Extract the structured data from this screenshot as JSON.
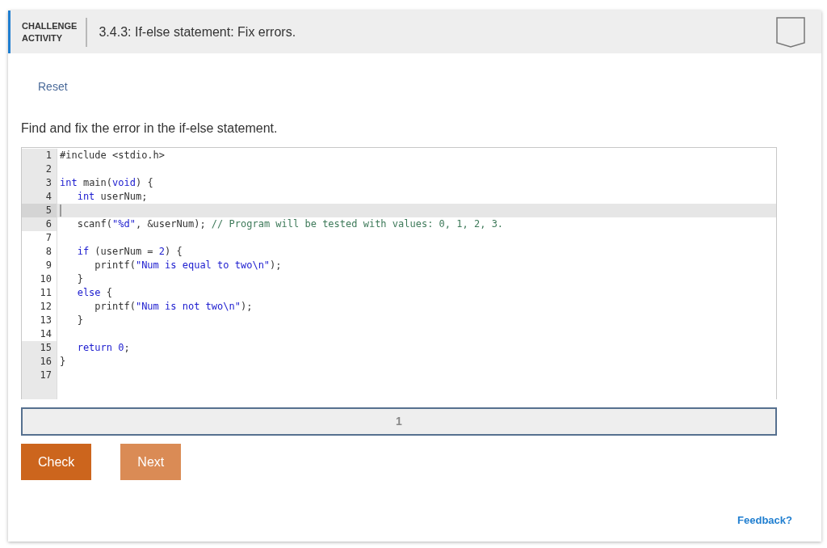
{
  "header": {
    "label_lines": [
      "CHALLENGE",
      "ACTIVITY"
    ],
    "title": "3.4.3: If-else statement: Fix errors."
  },
  "reset": "Reset",
  "instructions": "Find and fix the error in the if-else statement.",
  "editor": {
    "lines": [
      {
        "number": "1",
        "locked": true,
        "active": false,
        "tokens": [
          {
            "kind": "plain",
            "text": "#include <stdio.h>"
          }
        ]
      },
      {
        "number": "2",
        "locked": true,
        "active": false
      },
      {
        "number": "3",
        "locked": true,
        "active": false,
        "tokens": [
          {
            "kind": "keyword",
            "text": "int"
          },
          {
            "kind": "plain",
            "text": " main("
          },
          {
            "kind": "keyword",
            "text": "void"
          },
          {
            "kind": "plain",
            "text": ") {"
          }
        ]
      },
      {
        "number": "4",
        "locked": true,
        "active": false,
        "tokens": [
          {
            "kind": "keyword",
            "text": "   int"
          },
          {
            "kind": "plain",
            "text": " userNum;"
          }
        ]
      },
      {
        "number": "5",
        "locked": true,
        "active": true
      },
      {
        "number": "6",
        "locked": true,
        "active": false,
        "tokens": [
          {
            "kind": "plain",
            "text": "   scanf("
          },
          {
            "kind": "string",
            "text": "\"%d\""
          },
          {
            "kind": "plain",
            "text": ", &userNum); "
          },
          {
            "kind": "comment",
            "text": "// Program will be tested with values: 0, 1, 2, 3."
          }
        ]
      },
      {
        "number": "7",
        "locked": false,
        "active": false
      },
      {
        "number": "8",
        "locked": false,
        "active": false,
        "tokens": [
          {
            "kind": "keyword",
            "text": "   if"
          },
          {
            "kind": "plain",
            "text": " (userNum = "
          },
          {
            "kind": "number",
            "text": "2"
          },
          {
            "kind": "plain",
            "text": ") {"
          }
        ]
      },
      {
        "number": "9",
        "locked": false,
        "active": false,
        "tokens": [
          {
            "kind": "plain",
            "text": "      printf("
          },
          {
            "kind": "string",
            "text": "\"Num is equal to two\\n\""
          },
          {
            "kind": "plain",
            "text": ");"
          }
        ]
      },
      {
        "number": "10",
        "locked": false,
        "active": false,
        "tokens": [
          {
            "kind": "plain",
            "text": "   }"
          }
        ]
      },
      {
        "number": "11",
        "locked": false,
        "active": false,
        "tokens": [
          {
            "kind": "keyword",
            "text": "   else"
          },
          {
            "kind": "plain",
            "text": " {"
          }
        ]
      },
      {
        "number": "12",
        "locked": false,
        "active": false,
        "tokens": [
          {
            "kind": "plain",
            "text": "      printf("
          },
          {
            "kind": "string",
            "text": "\"Num is not two\\n\""
          },
          {
            "kind": "plain",
            "text": ");"
          }
        ]
      },
      {
        "number": "13",
        "locked": false,
        "active": false,
        "tokens": [
          {
            "kind": "plain",
            "text": "   }"
          }
        ]
      },
      {
        "number": "14",
        "locked": false,
        "active": false
      },
      {
        "number": "15",
        "locked": true,
        "active": false,
        "tokens": [
          {
            "kind": "keyword",
            "text": "   return 0"
          },
          {
            "kind": "plain",
            "text": ";"
          }
        ]
      },
      {
        "number": "16",
        "locked": true,
        "active": false,
        "tokens": [
          {
            "kind": "plain",
            "text": "}"
          }
        ]
      },
      {
        "number": "17",
        "locked": true,
        "active": false
      }
    ]
  },
  "progress": [
    {
      "label": "1",
      "selected": true
    }
  ],
  "buttons": [
    {
      "label": "Check",
      "disabled": false
    },
    {
      "label": "Next",
      "disabled": true
    }
  ],
  "feedback": "Feedback?"
}
